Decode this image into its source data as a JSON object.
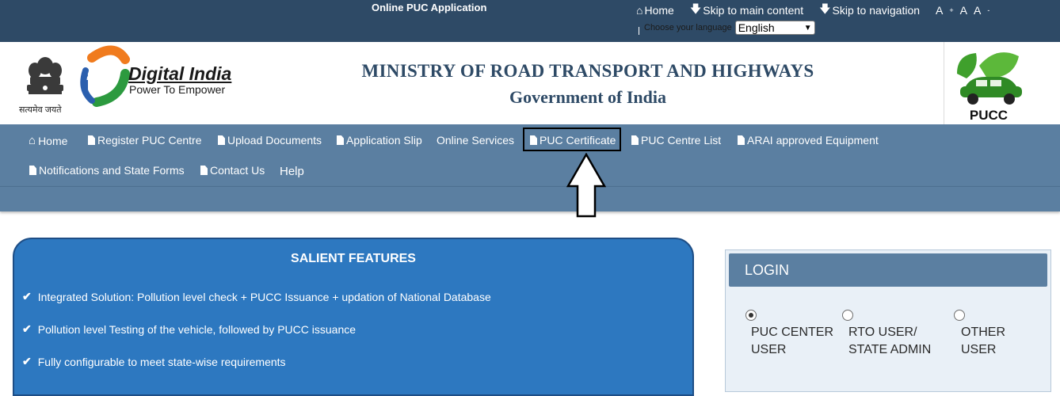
{
  "topbar": {
    "app_title": "Online PUC Application",
    "links": {
      "home": "Home",
      "skip_main": "Skip to main content",
      "skip_nav": "Skip to navigation"
    },
    "font_sizes": {
      "increase": "A",
      "normal": "A",
      "decrease": "A"
    },
    "language_label": "Choose your language",
    "language_value": "English"
  },
  "header": {
    "emblem_caption": "सत्यमेव जयते",
    "digital_india_title": "Digital India",
    "digital_india_tagline": "Power To Empower",
    "ministry_line1": "MINISTRY OF ROAD TRANSPORT AND HIGHWAYS",
    "ministry_line2": "Government of India",
    "pucc_logo_text": "PUCC"
  },
  "nav": {
    "home": "Home",
    "register_puc_centre": "Register PUC Centre",
    "upload_documents": "Upload Documents",
    "application_slip": "Application Slip",
    "online_services": "Online Services",
    "puc_certificate": "PUC Certificate",
    "puc_centre_list": "PUC Centre List",
    "arai_equipment": "ARAI approved Equipment",
    "notifications": "Notifications and State Forms",
    "contact_us": "Contact Us",
    "help": "Help"
  },
  "features": {
    "title": "SALIENT FEATURES",
    "items": [
      "Integrated Solution: Pollution level check + PUCC Issuance + updation of National Database",
      "Pollution level Testing of the vehicle, followed by PUCC issuance",
      "Fully configurable to meet state-wise requirements"
    ]
  },
  "login": {
    "title": "LOGIN",
    "options": [
      {
        "line1": "PUC CENTER",
        "line2": "USER",
        "selected": true
      },
      {
        "line1": "RTO USER/",
        "line2": "STATE ADMIN",
        "selected": false
      },
      {
        "line1": "OTHER",
        "line2": "USER",
        "selected": false
      }
    ]
  },
  "colors": {
    "topbar": "#2e4a66",
    "nav": "#5b7fa1",
    "features_panel": "#2d78c0",
    "ministry_text": "#2e4a66"
  }
}
